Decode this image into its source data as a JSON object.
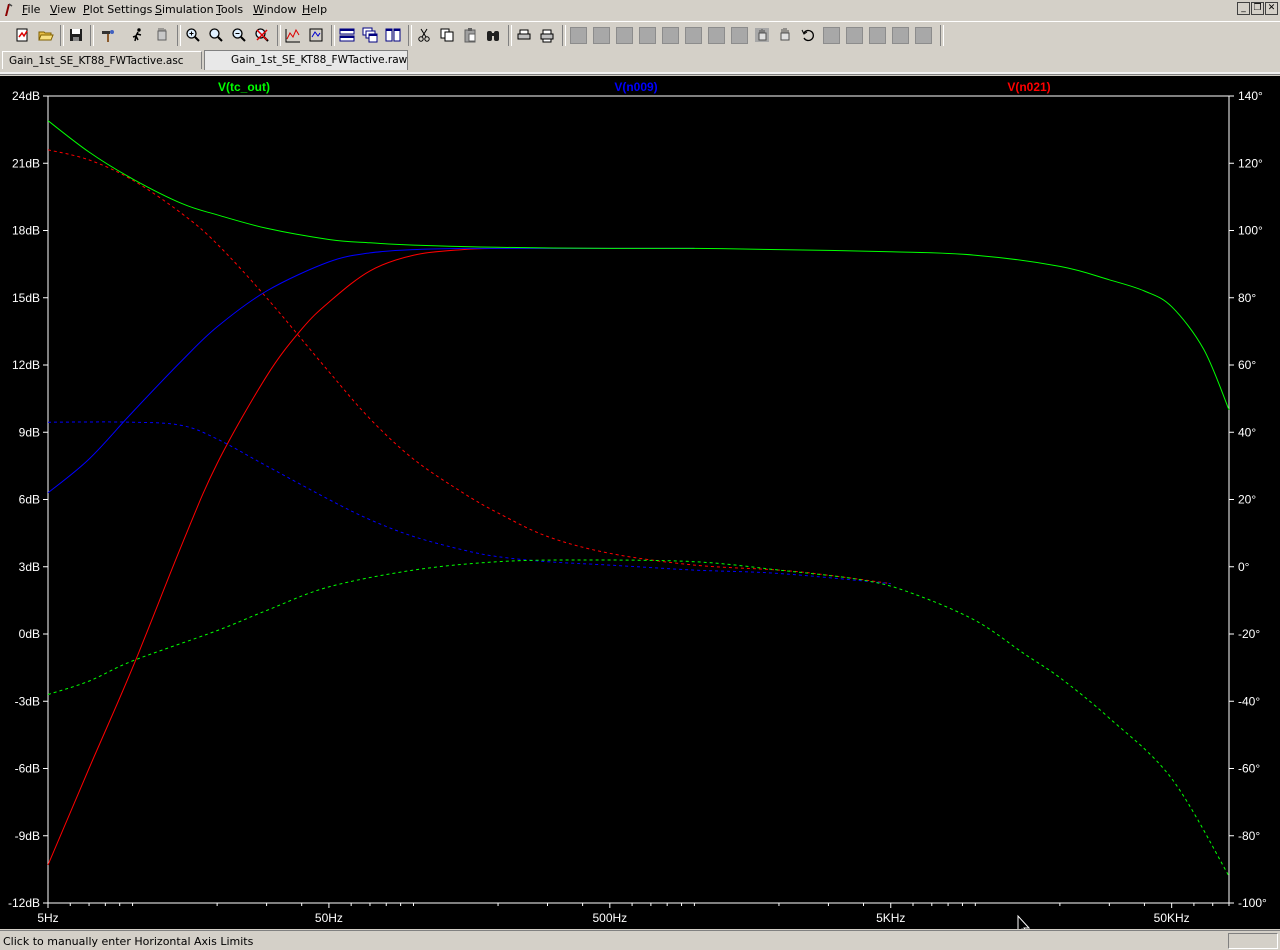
{
  "menu": {
    "items": [
      "File",
      "View",
      "Plot Settings",
      "Simulation",
      "Tools",
      "Window",
      "Help"
    ]
  },
  "window_controls": {
    "minimize": "_",
    "restore": "❐",
    "close": "✕"
  },
  "toolbar": {
    "buttons": [
      "new-schematic-icon",
      "open-folder-icon",
      "save-icon",
      "control-panel-hammer-icon",
      "run-icon",
      "halt-hand-icon",
      "zoom-in-icon",
      "zoom-area-icon",
      "zoom-out-icon",
      "zoom-cancel-icon",
      "autorange-icon",
      "pick-visible-traces-icon",
      "tile-horizontal-icon",
      "cascade-icon",
      "tile-vertical-icon",
      "cut-scissors-icon",
      "copy-icon",
      "paste-icon",
      "find-binoculars-icon",
      "print-preview-icon",
      "print-icon",
      "undo-icon"
    ]
  },
  "tabs": [
    {
      "label": "Gain_1st_SE_KT88_FWTactive.asc",
      "active": false
    },
    {
      "label": "Gain_1st_SE_KT88_FWTactive.raw",
      "active": true
    }
  ],
  "status": {
    "text": "Click to manually enter Horizontal Axis Limits"
  },
  "colors": {
    "background": "#000000",
    "axis": "#ffffff",
    "tc_out": "#00ff00",
    "n009": "#0000ff",
    "n021": "#ff0000",
    "overlap": "#ff00ff"
  },
  "chart_data": {
    "type": "line",
    "title": "",
    "xscale": "log",
    "xlim": [
      5,
      80000
    ],
    "xticks": [
      5,
      50,
      500,
      5000,
      50000
    ],
    "xtick_labels": [
      "5Hz",
      "50Hz",
      "500Hz",
      "5KHz",
      "50KHz"
    ],
    "ylim": [
      -12,
      24
    ],
    "yticks": [
      -12,
      -9,
      -6,
      -3,
      0,
      3,
      6,
      9,
      12,
      15,
      18,
      21,
      24
    ],
    "ytick_labels": [
      "-12dB",
      "-9dB",
      "-6dB",
      "-3dB",
      "0dB",
      "3dB",
      "6dB",
      "9dB",
      "12dB",
      "15dB",
      "18dB",
      "21dB",
      "24dB"
    ],
    "y2lim": [
      -100,
      140
    ],
    "y2ticks": [
      -100,
      -80,
      -60,
      -40,
      -20,
      0,
      20,
      40,
      60,
      80,
      100,
      120,
      140
    ],
    "y2tick_labels": [
      "-100°",
      "-80°",
      "-60°",
      "-40°",
      "-20°",
      "0°",
      "20°",
      "40°",
      "60°",
      "80°",
      "100°",
      "120°",
      "140°"
    ],
    "grid": false,
    "legend_placement": "top",
    "series": [
      {
        "name": "V(tc_out)",
        "color": "#00ff00",
        "gain_x": [
          5,
          7,
          10,
          15,
          20,
          30,
          50,
          70,
          100,
          200,
          500,
          1000,
          2000,
          5000,
          10000,
          20000,
          30000,
          40000,
          50000,
          65000,
          80000
        ],
        "gain_db": [
          22.9,
          21.5,
          20.3,
          19.2,
          18.7,
          18.1,
          17.6,
          17.45,
          17.35,
          17.25,
          17.2,
          17.2,
          17.15,
          17.05,
          16.9,
          16.4,
          15.8,
          15.3,
          14.6,
          12.7,
          10.0
        ],
        "phase_x": [
          5,
          7,
          10,
          20,
          30,
          50,
          100,
          200,
          400,
          1000,
          2000,
          4000,
          6000,
          10000,
          15000,
          20000,
          30000,
          50000,
          80000
        ],
        "phase_deg": [
          -38,
          -34,
          -28,
          -19,
          -13,
          -6,
          -1,
          1.5,
          2,
          1.5,
          -1,
          -4,
          -8,
          -16,
          -26,
          -33,
          -45,
          -63,
          -92
        ]
      },
      {
        "name": "V(n009)",
        "color": "#0000ff",
        "gain_x": [
          5,
          7,
          10,
          15,
          20,
          30,
          50,
          70,
          100,
          150,
          200,
          300,
          500,
          1000
        ],
        "gain_db": [
          6.3,
          7.8,
          9.9,
          12.2,
          13.7,
          15.3,
          16.6,
          17.0,
          17.15,
          17.2,
          17.2,
          17.2,
          17.2,
          17.2
        ],
        "phase_x": [
          5,
          10,
          15,
          20,
          30,
          50,
          70,
          100,
          150,
          200,
          300,
          500,
          1000,
          2000,
          5000
        ],
        "phase_deg": [
          43,
          43,
          42,
          38,
          30,
          20,
          14,
          9,
          5,
          3,
          1.5,
          0.5,
          -1,
          -2,
          -5
        ]
      },
      {
        "name": "V(n021)",
        "color": "#ff0000",
        "gain_x": [
          5,
          7,
          10,
          15,
          20,
          30,
          40,
          50,
          70,
          100,
          150,
          200,
          300,
          500,
          1000
        ],
        "gain_db": [
          -10.3,
          -6,
          -1.5,
          4,
          7.6,
          11.5,
          13.6,
          14.8,
          16.2,
          16.9,
          17.15,
          17.2,
          17.2,
          17.2,
          17.2
        ],
        "phase_x": [
          5,
          7,
          10,
          15,
          20,
          30,
          50,
          70,
          100,
          150,
          200,
          300,
          500,
          1000,
          2000,
          3000,
          5000
        ],
        "phase_deg": [
          124,
          121,
          115,
          105,
          96,
          80,
          58,
          44,
          32,
          22,
          16,
          9,
          4,
          0.5,
          -1,
          -2.5,
          -5
        ]
      }
    ]
  }
}
